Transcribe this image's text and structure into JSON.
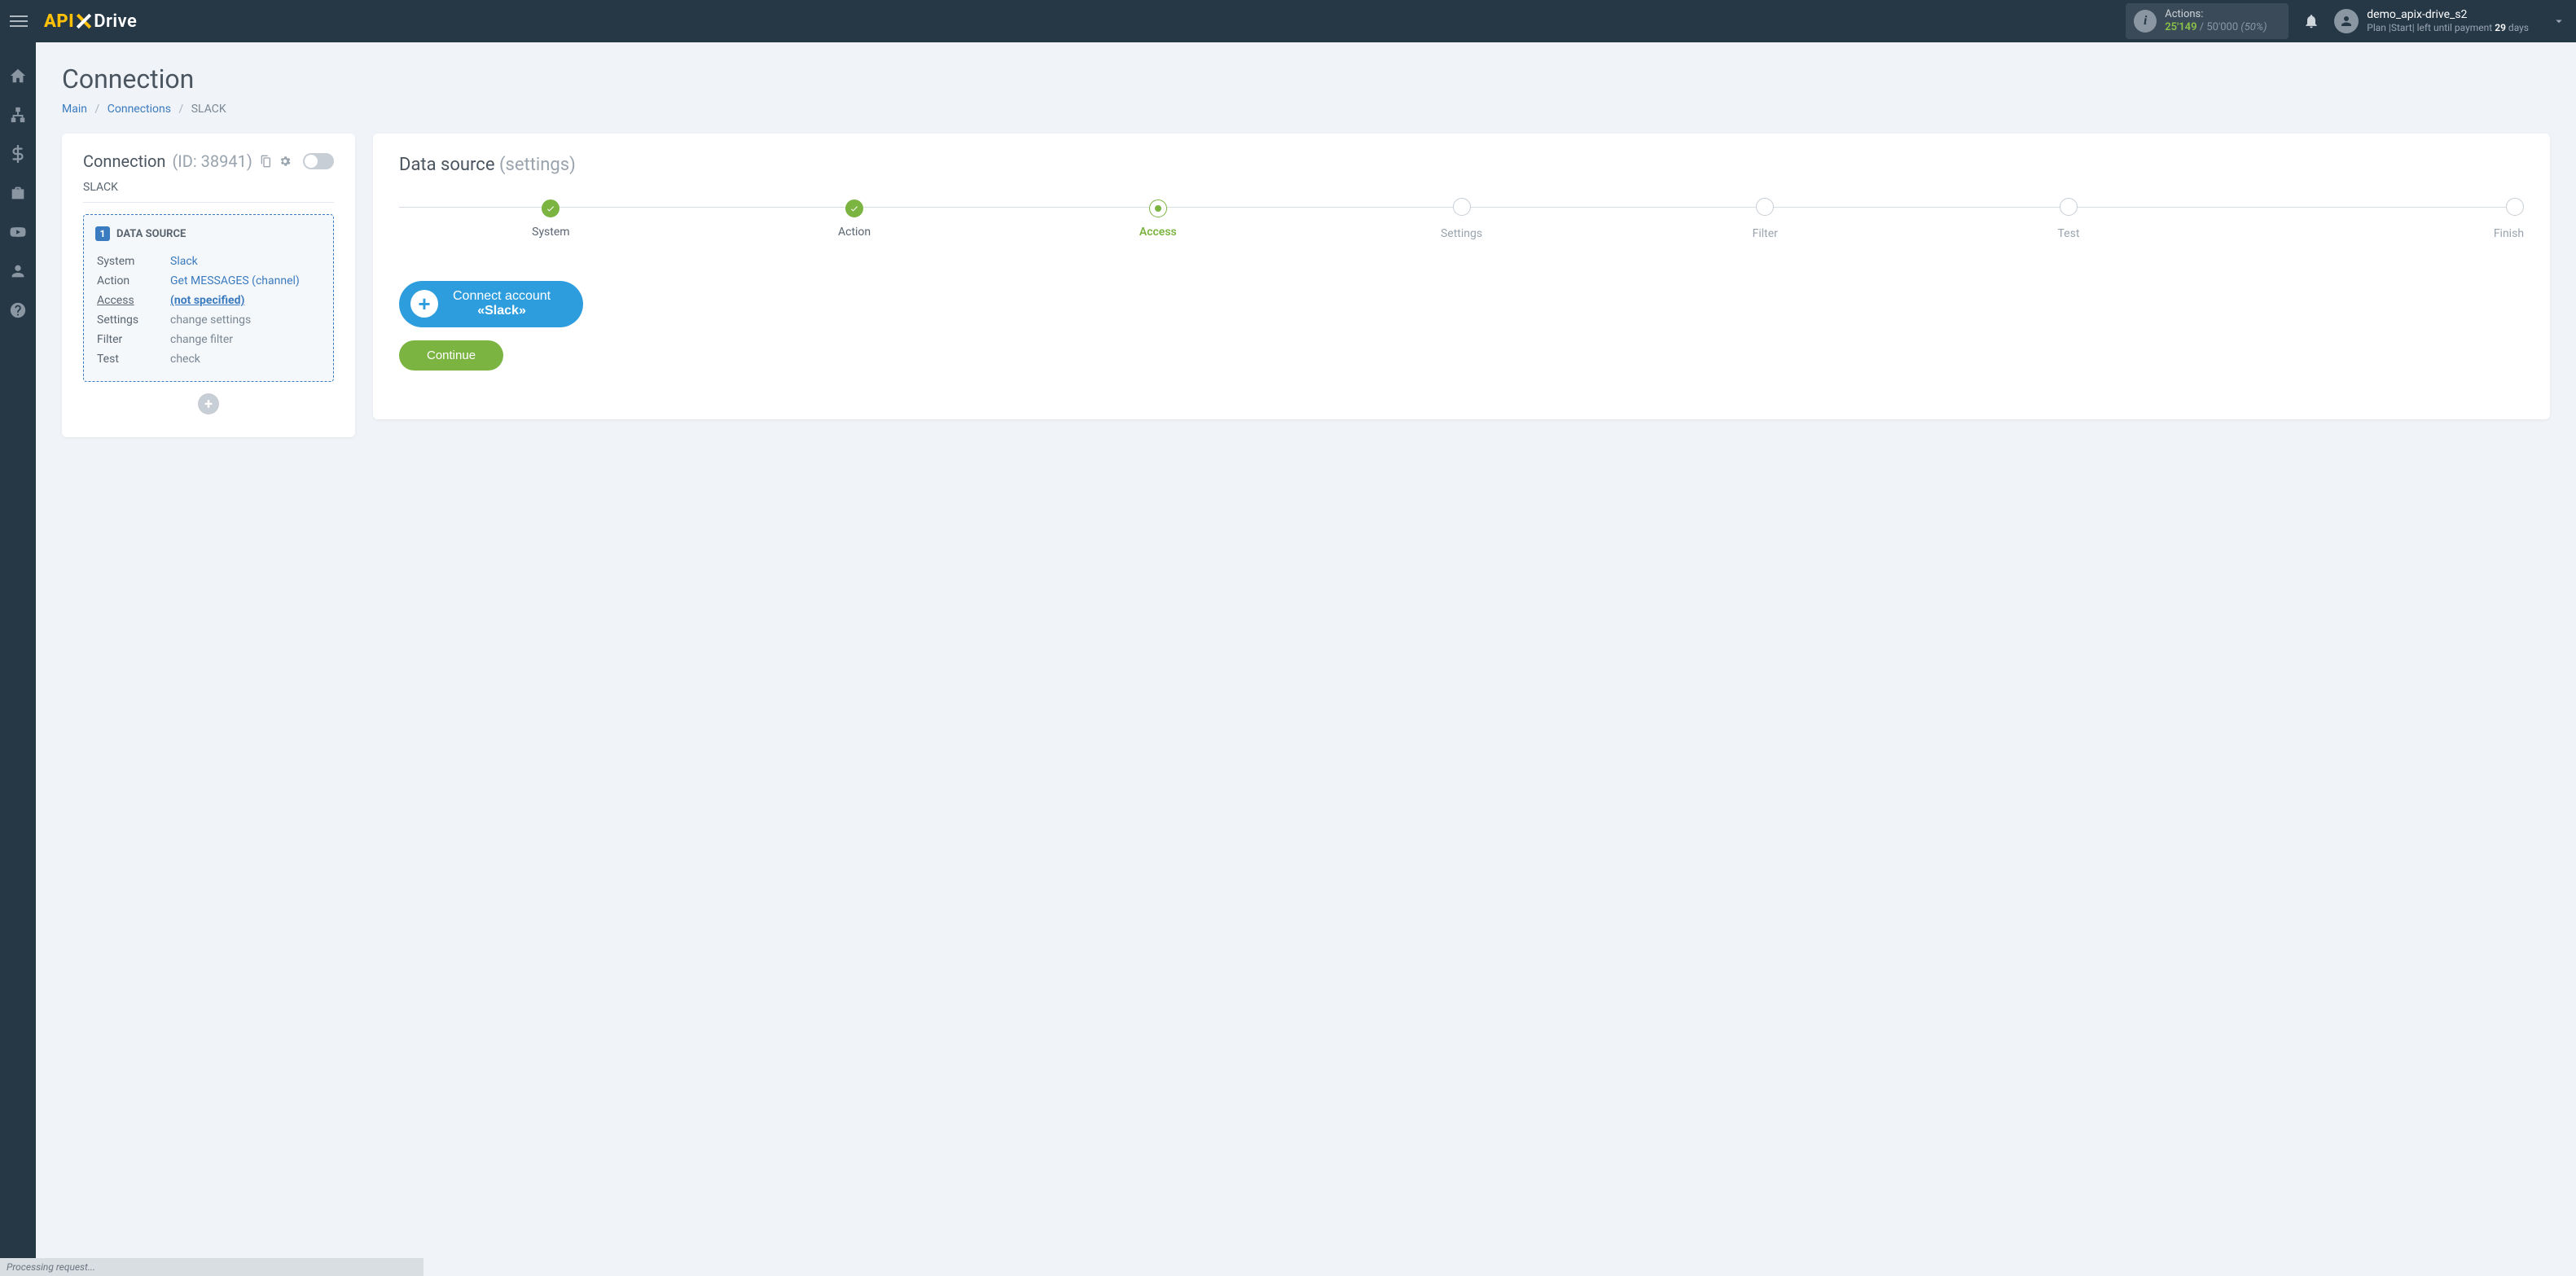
{
  "header": {
    "logo_api": "API",
    "logo_drive": "Drive",
    "actions_label": "Actions:",
    "actions_used": "25'149",
    "actions_total": "50'000",
    "actions_pct": "(50%)",
    "username": "demo_apix-drive_s2",
    "plan_prefix": "Plan |",
    "plan_name": "Start",
    "plan_mid": "| left until payment",
    "plan_days": "29",
    "plan_days_suffix": "days"
  },
  "page": {
    "title": "Connection",
    "crumb_main": "Main",
    "crumb_connections": "Connections",
    "crumb_current": "SLACK"
  },
  "left": {
    "title": "Connection",
    "id_label": "(ID: 38941)",
    "subtitle": "SLACK",
    "badge_num": "1",
    "ds_head": "DATA SOURCE",
    "rows": {
      "system_k": "System",
      "system_v": "Slack",
      "action_k": "Action",
      "action_v": "Get MESSAGES (channel)",
      "access_k": "Access",
      "access_v": "(not specified)",
      "settings_k": "Settings",
      "settings_v": "change settings",
      "filter_k": "Filter",
      "filter_v": "change filter",
      "test_k": "Test",
      "test_v": "check"
    }
  },
  "right": {
    "title": "Data source",
    "title_sub": "(settings)",
    "steps": {
      "system": "System",
      "action": "Action",
      "access": "Access",
      "settings": "Settings",
      "filter": "Filter",
      "test": "Test",
      "finish": "Finish"
    },
    "connect_line1": "Connect account",
    "connect_line2": "«Slack»",
    "continue": "Continue"
  },
  "footer": {
    "processing": "Processing request..."
  }
}
